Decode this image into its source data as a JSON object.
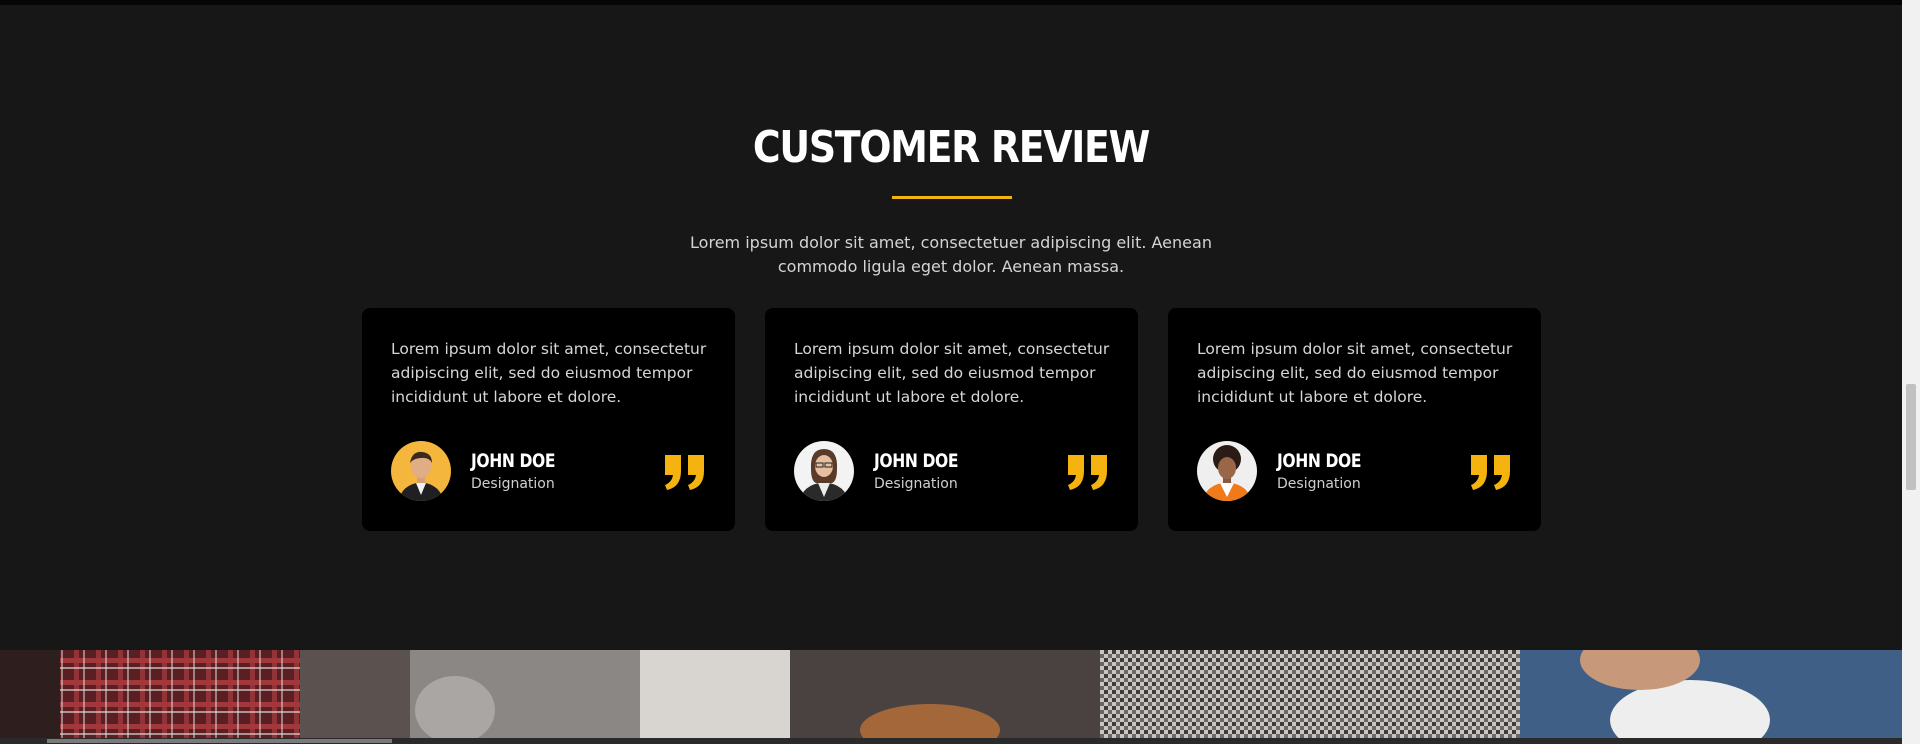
{
  "section": {
    "title": "CUSTOMER REVIEW",
    "subtitle": "Lorem ipsum dolor sit amet, consectetuer adipiscing elit. Aenean commodo ligula eget dolor. Aenean massa."
  },
  "colors": {
    "accent": "#f5b30f",
    "background": "#171717",
    "card": "#000000"
  },
  "reviews": [
    {
      "text": "Lorem ipsum dolor sit amet, consectetur adipiscing elit, sed do eiusmod tempor incididunt ut labore et dolore.",
      "name": "JOHN DOE",
      "designation": "Designation",
      "avatar": "man-in-suit-avatar",
      "icon": "quote-icon"
    },
    {
      "text": "Lorem ipsum dolor sit amet, consectetur adipiscing elit, sed do eiusmod tempor incididunt ut labore et dolore.",
      "name": "JOHN DOE",
      "designation": "Designation",
      "avatar": "woman-with-glasses-avatar",
      "icon": "quote-icon"
    },
    {
      "text": "Lorem ipsum dolor sit amet, consectetur adipiscing elit, sed do eiusmod tempor incididunt ut labore et dolore.",
      "name": "JOHN DOE",
      "designation": "Designation",
      "avatar": "woman-in-orange-avatar",
      "icon": "quote-icon"
    }
  ]
}
